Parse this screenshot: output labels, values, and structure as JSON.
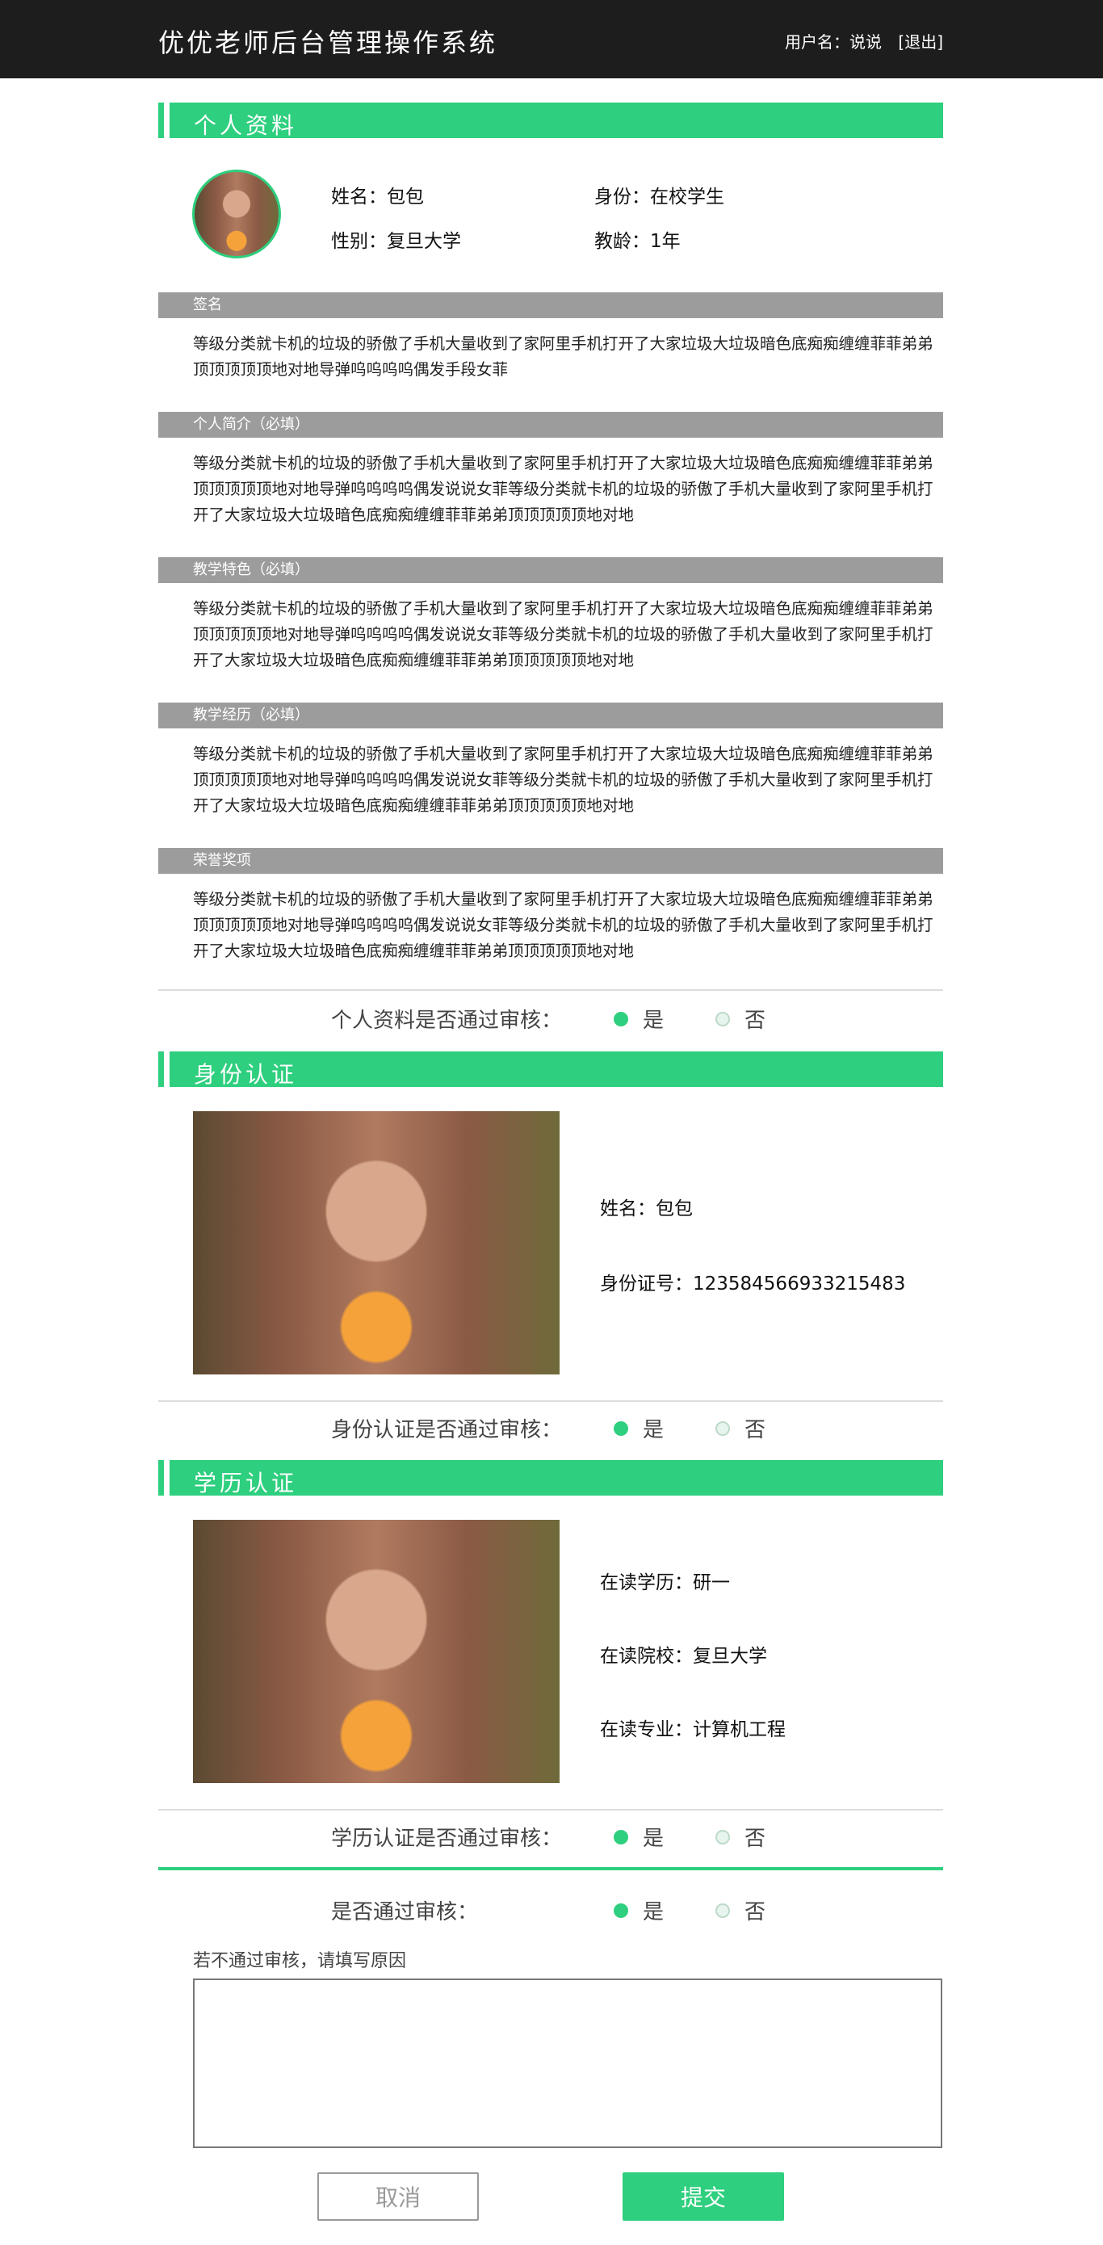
{
  "header": {
    "title": "优优老师后台管理操作系统",
    "user_label": "用户名：说说",
    "logout": "[退出]"
  },
  "profile": {
    "section_title": "个人资料",
    "name": "姓名：包包",
    "identity": "身份：在校学生",
    "gender": "性别：复旦大学",
    "teach_age": "教龄：1年",
    "signature": {
      "heading": "签名",
      "text": "等级分类就卡机的垃圾的骄傲了手机大量收到了家阿里手机打开了大家垃圾大垃圾暗色底痴痴缠缠菲菲弟弟顶顶顶顶顶地对地导弹呜呜呜呜偶发手段女菲"
    },
    "intro": {
      "heading": "个人简介（必填）",
      "text": "等级分类就卡机的垃圾的骄傲了手机大量收到了家阿里手机打开了大家垃圾大垃圾暗色底痴痴缠缠菲菲弟弟顶顶顶顶顶地对地导弹呜呜呜呜偶发说说女菲等级分类就卡机的垃圾的骄傲了手机大量收到了家阿里手机打开了大家垃圾大垃圾暗色底痴痴缠缠菲菲弟弟顶顶顶顶顶地对地"
    },
    "feature": {
      "heading": "教学特色（必填）",
      "text": "等级分类就卡机的垃圾的骄傲了手机大量收到了家阿里手机打开了大家垃圾大垃圾暗色底痴痴缠缠菲菲弟弟顶顶顶顶顶地对地导弹呜呜呜呜偶发说说女菲等级分类就卡机的垃圾的骄傲了手机大量收到了家阿里手机打开了大家垃圾大垃圾暗色底痴痴缠缠菲菲弟弟顶顶顶顶顶地对地"
    },
    "experience": {
      "heading": "教学经历（必填）",
      "text": "等级分类就卡机的垃圾的骄傲了手机大量收到了家阿里手机打开了大家垃圾大垃圾暗色底痴痴缠缠菲菲弟弟顶顶顶顶顶地对地导弹呜呜呜呜偶发说说女菲等级分类就卡机的垃圾的骄傲了手机大量收到了家阿里手机打开了大家垃圾大垃圾暗色底痴痴缠缠菲菲弟弟顶顶顶顶顶地对地"
    },
    "honors": {
      "heading": "荣誉奖项",
      "text": "等级分类就卡机的垃圾的骄傲了手机大量收到了家阿里手机打开了大家垃圾大垃圾暗色底痴痴缠缠菲菲弟弟顶顶顶顶顶地对地导弹呜呜呜呜偶发说说女菲等级分类就卡机的垃圾的骄傲了手机大量收到了家阿里手机打开了大家垃圾大垃圾暗色底痴痴缠缠菲菲弟弟顶顶顶顶顶地对地"
    },
    "audit": {
      "question": "个人资料是否通过审核：",
      "yes": "是",
      "no": "否"
    }
  },
  "identity_auth": {
    "section_title": "身份认证",
    "name": "姓名：包包",
    "id_number": "身份证号：123584566933215483",
    "audit": {
      "question": "身份认证是否通过审核：",
      "yes": "是",
      "no": "否"
    }
  },
  "education_auth": {
    "section_title": "学历认证",
    "degree": "在读学历：研一",
    "school": "在读院校：复旦大学",
    "major": "在读专业：计算机工程",
    "audit": {
      "question": "学历认证是否通过审核：",
      "yes": "是",
      "no": "否"
    }
  },
  "final": {
    "question": "是否通过审核：",
    "yes": "是",
    "no": "否",
    "reason_label": "若不通过审核，请填写原因",
    "reason_value": "",
    "cancel": "取消",
    "submit": "提交"
  },
  "colors": {
    "accent": "#2ecf7e",
    "topbar": "#1d1d1d",
    "gray_heading": "#9c9c9c"
  }
}
